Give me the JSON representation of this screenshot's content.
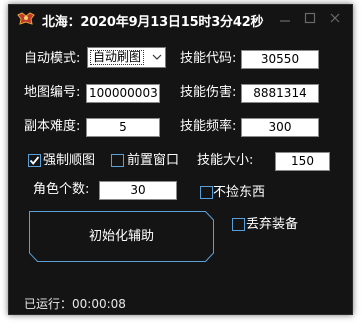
{
  "window": {
    "title": "北海：2020年9月13日15时3分42秒",
    "icon": "game-crest-icon",
    "controls": [
      "minimize-icon",
      "maximize-icon",
      "close-icon"
    ],
    "background": "#141414",
    "accent": "#5aa0d8"
  },
  "form": {
    "mode_label": "自动模式:",
    "mode_value": "自动刷图",
    "skill_code_label": "技能代码:",
    "skill_code_value": "30550",
    "map_id_label": "地图编号:",
    "map_id_value": "100000003",
    "skill_damage_label": "技能伤害:",
    "skill_damage_value": "8881314",
    "dungeon_difficulty_label": "副本难度:",
    "dungeon_difficulty_value": "5",
    "skill_frequency_label": "技能频率:",
    "skill_frequency_value": "300",
    "force_map_label": "强制顺图",
    "force_map_checked": true,
    "front_window_label": "前置窗口",
    "front_window_checked": false,
    "skill_size_label": "技能大小:",
    "skill_size_value": "150",
    "role_count_label": "角色个数:",
    "role_count_value": "30",
    "no_pickup_label": "不捡东西",
    "no_pickup_checked": false,
    "discard_equipment_label": "丢弃装备",
    "discard_equipment_checked": false,
    "init_button_label": "初始化辅助"
  },
  "status": {
    "running_label": "已运行：",
    "running_time": "00:00:08"
  }
}
